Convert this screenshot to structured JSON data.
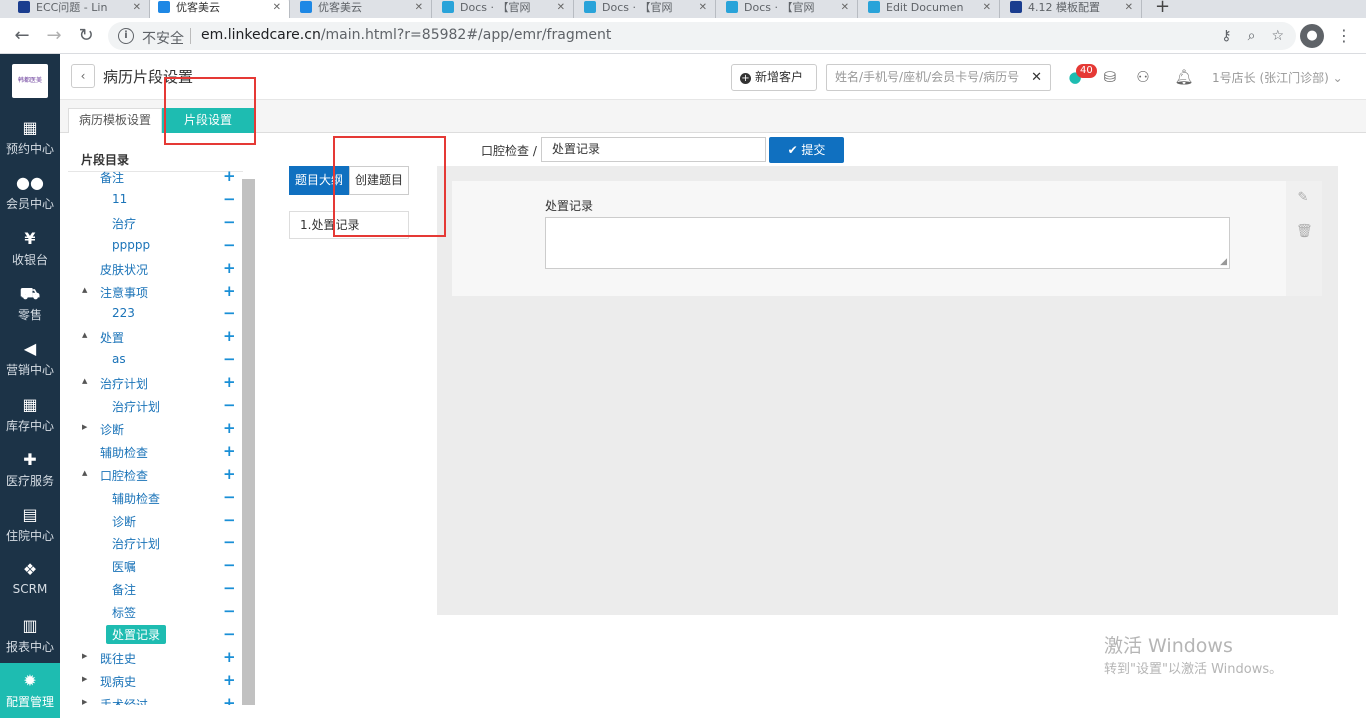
{
  "browser": {
    "tabs": [
      {
        "title": "ECC问题 - Lin",
        "active": false
      },
      {
        "title": "优客美云",
        "active": true
      },
      {
        "title": "优客美云",
        "active": false
      },
      {
        "title": "Docs · 【官网",
        "active": false
      },
      {
        "title": "Docs · 【官网",
        "active": false
      },
      {
        "title": "Docs · 【官网",
        "active": false
      },
      {
        "title": "Edit Documen",
        "active": false
      },
      {
        "title": "4.12 模板配置",
        "active": false
      }
    ],
    "security_label": "不安全",
    "url_host": "em.linkedcare.cn",
    "url_rest": "/main.html?r=85982#/app/emr/fragment"
  },
  "app_nav": {
    "logo_text": "韩都医美",
    "items": [
      {
        "label": "预约中心",
        "icon": "calendar-icon",
        "glyph": "▦",
        "active": false
      },
      {
        "label": "会员中心",
        "icon": "members-icon",
        "glyph": "●●",
        "active": false
      },
      {
        "label": "收银台",
        "icon": "yen-icon",
        "glyph": "¥",
        "active": false
      },
      {
        "label": "零售",
        "icon": "cart-icon",
        "glyph": "⛟",
        "active": false
      },
      {
        "label": "营销中心",
        "icon": "megaphone-icon",
        "glyph": "◀",
        "active": false
      },
      {
        "label": "库存中心",
        "icon": "grid-icon",
        "glyph": "▦",
        "active": false
      },
      {
        "label": "医疗服务",
        "icon": "medkit-icon",
        "glyph": "✚",
        "active": false
      },
      {
        "label": "住院中心",
        "icon": "clipboard-icon",
        "glyph": "▤",
        "active": false
      },
      {
        "label": "SCRM",
        "icon": "cubes-icon",
        "glyph": "❖",
        "active": false
      },
      {
        "label": "报表中心",
        "icon": "bar-chart-icon",
        "glyph": "▥",
        "active": false
      },
      {
        "label": "配置管理",
        "icon": "gear-icon",
        "glyph": "✹",
        "active": true
      }
    ]
  },
  "header": {
    "title": "病历片段设置",
    "new_customer": "新增客户",
    "search_placeholder": "姓名/手机号/座机/会员卡号/病历号",
    "badge_count": "40",
    "user": "1号店长 (张江门诊部)"
  },
  "subtabs": [
    {
      "label": "病历模板设置",
      "active": false
    },
    {
      "label": "片段设置",
      "active": true
    }
  ],
  "tree": {
    "title": "片段目录",
    "nodes": [
      {
        "label": "备注",
        "level": 1,
        "caret": "",
        "action": "+"
      },
      {
        "label": "11",
        "level": 2,
        "caret": "",
        "action": "−"
      },
      {
        "label": "治疗",
        "level": 2,
        "caret": "",
        "action": "−"
      },
      {
        "label": "ppppp",
        "level": 2,
        "caret": "",
        "action": "−"
      },
      {
        "label": "皮肤状况",
        "level": 1,
        "caret": "",
        "action": "+"
      },
      {
        "label": "注意事项",
        "level": 1,
        "caret": "▲",
        "action": "+"
      },
      {
        "label": "223",
        "level": 2,
        "caret": "",
        "action": "−"
      },
      {
        "label": "处置",
        "level": 1,
        "caret": "▲",
        "action": "+"
      },
      {
        "label": "as",
        "level": 2,
        "caret": "",
        "action": "−"
      },
      {
        "label": "治疗计划",
        "level": 1,
        "caret": "▲",
        "action": "+"
      },
      {
        "label": "治疗计划",
        "level": 2,
        "caret": "",
        "action": "−"
      },
      {
        "label": "诊断",
        "level": 1,
        "caret": "▶",
        "action": "+"
      },
      {
        "label": "辅助检查",
        "level": 1,
        "caret": "",
        "action": "+"
      },
      {
        "label": "口腔检查",
        "level": 1,
        "caret": "▲",
        "action": "+"
      },
      {
        "label": "辅助检查",
        "level": 2,
        "caret": "",
        "action": "−"
      },
      {
        "label": "诊断",
        "level": 2,
        "caret": "",
        "action": "−"
      },
      {
        "label": "治疗计划",
        "level": 2,
        "caret": "",
        "action": "−"
      },
      {
        "label": "医嘱",
        "level": 2,
        "caret": "",
        "action": "−"
      },
      {
        "label": "备注",
        "level": 2,
        "caret": "",
        "action": "−"
      },
      {
        "label": "标签",
        "level": 2,
        "caret": "",
        "action": "−"
      },
      {
        "label": "处置记录",
        "level": 2,
        "caret": "",
        "action": "−",
        "selected": true
      },
      {
        "label": "既往史",
        "level": 1,
        "caret": "▶",
        "action": "+"
      },
      {
        "label": "现病史",
        "level": 1,
        "caret": "▶",
        "action": "+"
      },
      {
        "label": "手术经过",
        "level": 1,
        "caret": "▶",
        "action": "+"
      }
    ]
  },
  "middle": {
    "tab_outline": "题目大纲",
    "tab_create": "创建题目",
    "item": "1.处置记录"
  },
  "editor": {
    "breadcrumb": "口腔检查 /",
    "name_value": "处置记录",
    "submit": "✔ 提交",
    "field_label": "处置记录"
  },
  "watermark": {
    "line1": "激活 Windows",
    "line2": "转到\"设置\"以激活 Windows。"
  },
  "colors": {
    "accent": "#1ebcb1",
    "primary": "#1070c0",
    "sidebar": "#1c3347",
    "annotation": "#e53935"
  }
}
